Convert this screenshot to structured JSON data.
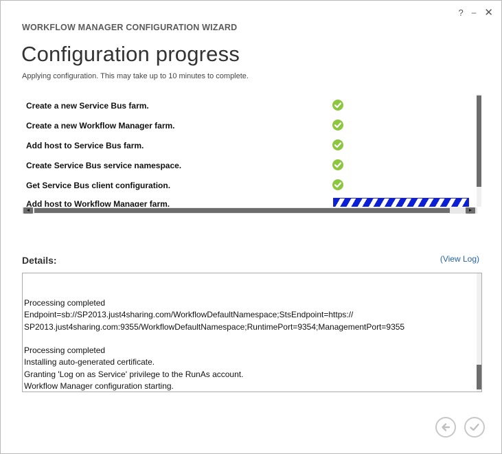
{
  "window": {
    "controls": {
      "help": "?",
      "minimize": "–",
      "close": "✕"
    }
  },
  "header": {
    "wizard_title": "WORKFLOW MANAGER CONFIGURATION WIZARD",
    "page_title": "Configuration progress",
    "subtitle": "Applying configuration. This may take up to 10 minutes to complete."
  },
  "steps": [
    {
      "label": "Create a new Service Bus farm.",
      "status": "completed",
      "status_icon": "check-circle-icon"
    },
    {
      "label": "Create a new Workflow Manager farm.",
      "status": "completed",
      "status_icon": "check-circle-icon"
    },
    {
      "label": "Add host to Service Bus farm.",
      "status": "completed",
      "status_icon": "check-circle-icon"
    },
    {
      "label": "Create Service Bus service namespace.",
      "status": "completed",
      "status_icon": "check-circle-icon"
    },
    {
      "label": "Get Service Bus client configuration.",
      "status": "completed",
      "status_icon": "check-circle-icon"
    },
    {
      "label": "Add host to Workflow Manager farm.",
      "status": "in-progress",
      "status_icon": "progress-bar"
    }
  ],
  "details": {
    "heading": "Details:",
    "view_log_label": "(View Log)",
    "lines": [
      "",
      "",
      "Processing completed",
      "Endpoint=sb://SP2013.just4sharing.com/WorkflowDefaultNamespace;StsEndpoint=https://",
      "SP2013.just4sharing.com:9355/WorkflowDefaultNamespace;RuntimePort=9354;ManagementPort=9355",
      "",
      "Processing completed",
      "Installing auto-generated certificate.",
      "Granting 'Log on as Service' privilege to the RunAs account.",
      "Workflow Manager configuration starting."
    ]
  },
  "navigation": {
    "back_icon": "arrow-left-circle-icon",
    "finish_icon": "check-circle-outline-icon"
  },
  "colors": {
    "success": "#8dc63f",
    "progress": "#0b1fd6",
    "link": "#2563a8",
    "scrollbar": "#6d6d6d"
  }
}
